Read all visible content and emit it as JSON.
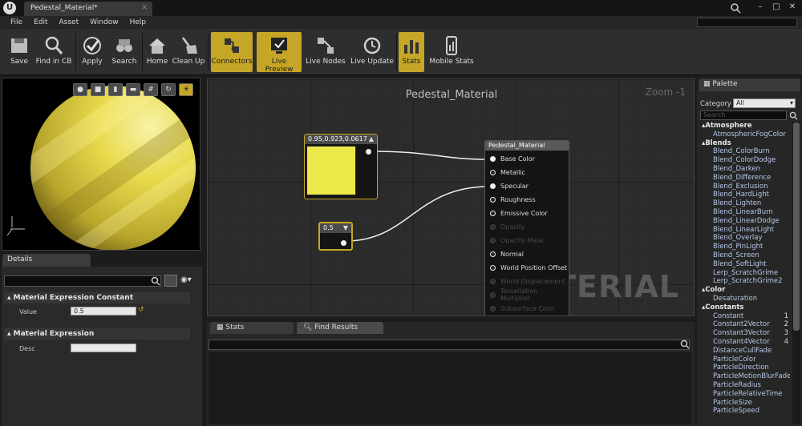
{
  "title_bar": {
    "logo": "U",
    "tab_title": "Pedestal_Material*"
  },
  "menu": [
    "File",
    "Edit",
    "Asset",
    "Window",
    "Help"
  ],
  "toolbar": {
    "buttons": [
      {
        "label": "Save",
        "icon": "save-icon",
        "active": false
      },
      {
        "label": "Find in CB",
        "icon": "magnifier-icon",
        "active": false
      },
      {
        "label": "Apply",
        "icon": "checkmark-icon",
        "active": false
      },
      {
        "label": "Search",
        "icon": "binoculars-icon",
        "active": false
      },
      {
        "label": "Home",
        "icon": "home-icon",
        "active": false
      },
      {
        "label": "Clean Up",
        "icon": "broom-icon",
        "active": false
      },
      {
        "label": "Connectors",
        "icon": "connectors-icon",
        "active": true
      },
      {
        "label": "Live Preview",
        "icon": "live-preview-icon",
        "active": true
      },
      {
        "label": "Live Nodes",
        "icon": "live-nodes-icon",
        "active": false
      },
      {
        "label": "Live Update",
        "icon": "live-update-icon",
        "active": false
      },
      {
        "label": "Stats",
        "icon": "stats-icon",
        "active": true
      },
      {
        "label": "Mobile Stats",
        "icon": "mobile-stats-icon",
        "active": false
      }
    ]
  },
  "details": {
    "tab": "Details",
    "sections": [
      {
        "title": "Material Expression Constant",
        "prop": "Value",
        "value": "0.5"
      },
      {
        "title": "Material Expression",
        "prop": "Desc",
        "value": ""
      }
    ]
  },
  "graph": {
    "title": "Pedestal_Material",
    "zoom": "Zoom -1",
    "watermark": "MATERIAL",
    "color_node": {
      "title": "0.95,0.923,0.0617",
      "color": "#ece84a"
    },
    "scalar_node": {
      "title": "0.5"
    },
    "result_node": {
      "title": "Pedestal_Material",
      "pins": [
        {
          "label": "Base Color",
          "enabled": true
        },
        {
          "label": "Metallic",
          "enabled": true
        },
        {
          "label": "Specular",
          "enabled": true
        },
        {
          "label": "Roughness",
          "enabled": true
        },
        {
          "label": "Emissive Color",
          "enabled": true
        },
        {
          "label": "Opacity",
          "enabled": false
        },
        {
          "label": "Opacity Mask",
          "enabled": false
        },
        {
          "label": "Normal",
          "enabled": true
        },
        {
          "label": "World Position Offset",
          "enabled": true
        },
        {
          "label": "World Displacement",
          "enabled": false
        },
        {
          "label": "Tessellation Multiplier",
          "enabled": false
        },
        {
          "label": "Subsurface Color",
          "enabled": false
        }
      ]
    }
  },
  "bottom_tabs": [
    "Stats",
    "Find Results"
  ],
  "palette": {
    "tab": "Palette",
    "category_label": "Category",
    "category_value": "All",
    "search_placeholder": "Search",
    "groups": [
      {
        "name": "Atmosphere",
        "items": [
          "AtmosphericFogColor"
        ]
      },
      {
        "name": "Blends",
        "items": [
          "Blend_ColorBurn",
          "Blend_ColorDodge",
          "Blend_Darken",
          "Blend_Difference",
          "Blend_Exclusion",
          "Blend_HardLight",
          "Blend_Lighten",
          "Blend_LinearBurn",
          "Blend_LinearDodge",
          "Blend_LinearLight",
          "Blend_Overlay",
          "Blend_PinLight",
          "Blend_Screen",
          "Blend_SoftLight",
          "Lerp_ScratchGrime",
          "Lerp_ScratchGrime2"
        ]
      },
      {
        "name": "Color",
        "items": [
          "Desaturation"
        ]
      },
      {
        "name": "Constants",
        "items": [
          "Constant",
          "Constant2Vector",
          "Constant3Vector",
          "Constant4Vector",
          "DistanceCullFade",
          "ParticleColor",
          "ParticleDirection",
          "ParticleMotionBlurFade",
          "ParticleRadius",
          "ParticleRelativeTime",
          "ParticleSize",
          "ParticleSpeed"
        ]
      }
    ],
    "hotkeys": {
      "Constant": "1",
      "Constant2Vector": "2",
      "Constant3Vector": "3",
      "Constant4Vector": "4"
    }
  },
  "colors": {
    "accent": "#c6a626",
    "sphere": "#e6d84a"
  }
}
